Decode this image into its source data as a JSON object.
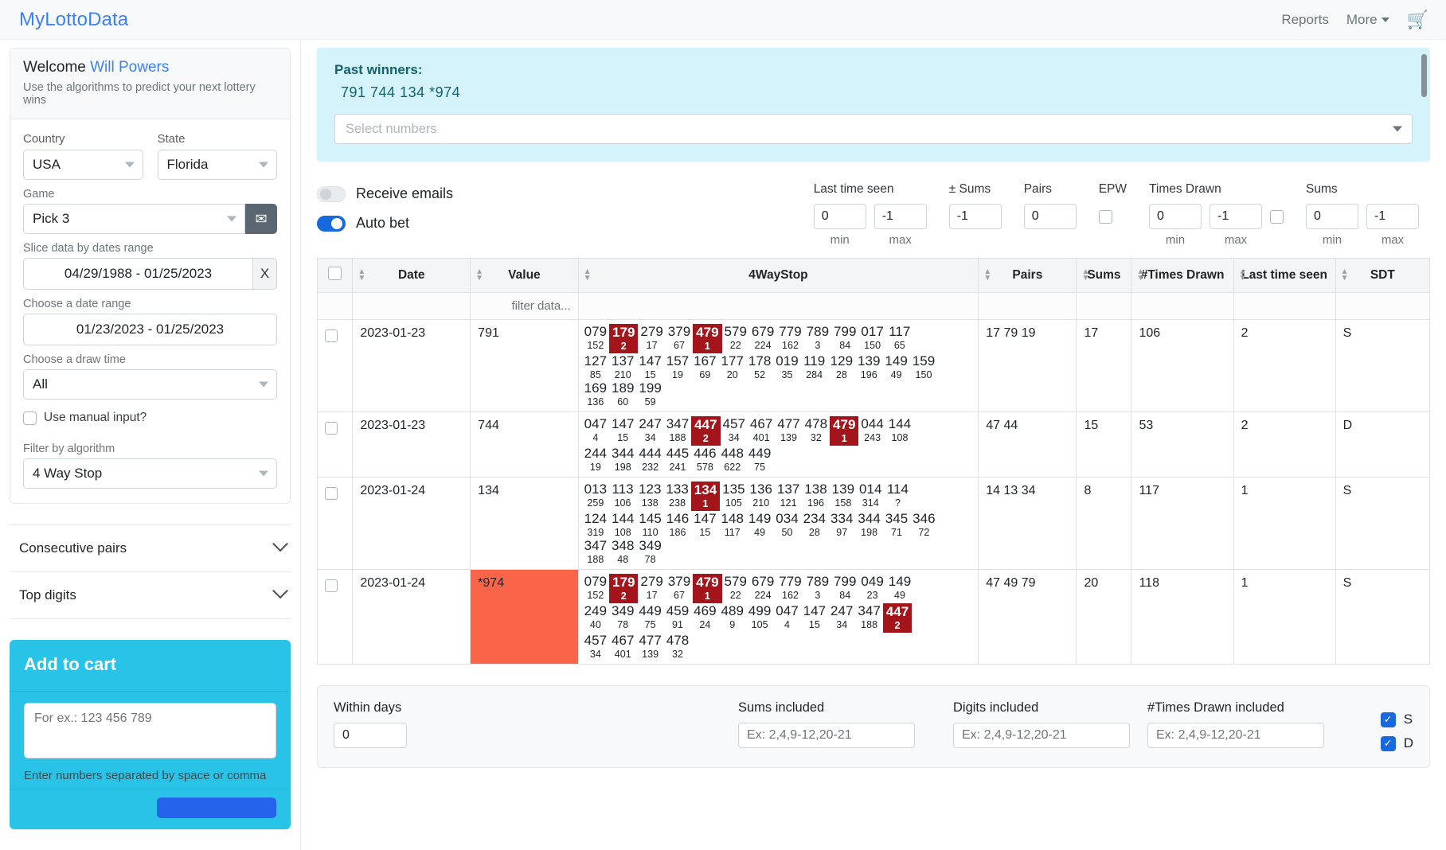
{
  "nav": {
    "brand": "MyLottoData",
    "links": [
      "Reports",
      "More"
    ],
    "cart_icon": "shopping-cart-icon"
  },
  "sidebar": {
    "welcome_prefix": "Welcome ",
    "user": "Will Powers",
    "subtitle": "Use the algorithms to predict your next lottery wins",
    "country_label": "Country",
    "country_value": "USA",
    "state_label": "State",
    "state_value": "Florida",
    "game_label": "Game",
    "game_value": "Pick 3",
    "mail_icon": "envelope-icon",
    "slice_label": "Slice data by dates range",
    "slice_value": "04/29/1988 - 01/25/2023",
    "slice_clear": "X",
    "range_label": "Choose a date range",
    "range_value": "01/23/2023 - 01/25/2023",
    "drawtime_label": "Choose a draw time",
    "drawtime_value": "All",
    "manual_label": "Use manual input?",
    "algo_label": "Filter by algorithm",
    "algo_value": "4 Way Stop",
    "accordion": [
      "Consecutive pairs",
      "Top digits"
    ],
    "cart_title": "Add to cart",
    "cart_placeholder": "For ex.: 123 456 789",
    "cart_hint": "Enter numbers separated by space or comma"
  },
  "past_winners": {
    "title": "Past winners:",
    "numbers": "791  744  134  *974",
    "select_placeholder": "Select numbers"
  },
  "controls": {
    "receive_emails_label": "Receive emails",
    "receive_emails_on": false,
    "auto_bet_label": "Auto bet",
    "auto_bet_on": true,
    "groups": [
      {
        "title": "Last time seen",
        "inputs": [
          "0",
          "-1"
        ],
        "minmax": [
          "min",
          "max"
        ],
        "checkbox": false
      },
      {
        "title": "± Sums",
        "inputs": [
          "-1"
        ],
        "minmax": [],
        "checkbox": false
      },
      {
        "title": "Pairs",
        "inputs": [
          "0"
        ],
        "minmax": [],
        "checkbox": false
      },
      {
        "title": "EPW",
        "inputs": [],
        "minmax": [],
        "checkbox": true
      },
      {
        "title": "Times Drawn",
        "inputs": [
          "0",
          "-1"
        ],
        "minmax": [
          "min",
          "max"
        ],
        "checkbox": true
      },
      {
        "title": "Sums",
        "inputs": [
          "0",
          "-1"
        ],
        "minmax": [
          "min",
          "max"
        ],
        "checkbox": false
      }
    ]
  },
  "table": {
    "columns": [
      "Date",
      "Value",
      "4WayStop",
      "Pairs",
      "Sums",
      "#Times Drawn",
      "Last time seen",
      "SDT"
    ],
    "filter_placeholder": "filter data...",
    "rows": [
      {
        "date": "2023-01-23",
        "value": "791",
        "value_highlight": false,
        "lines": [
          [
            [
              "079",
              "152",
              false
            ],
            [
              "179",
              "2",
              true
            ],
            [
              "279",
              "17",
              false
            ],
            [
              "379",
              "67",
              false
            ],
            [
              "479",
              "1",
              true
            ],
            [
              "579",
              "22",
              false
            ],
            [
              "679",
              "224",
              false
            ],
            [
              "779",
              "162",
              false
            ],
            [
              "789",
              "3",
              false
            ],
            [
              "799",
              "84",
              false
            ],
            [
              "017",
              "150",
              false
            ],
            [
              "117",
              "65",
              false
            ]
          ],
          [
            [
              "127",
              "85",
              false
            ],
            [
              "137",
              "210",
              false
            ],
            [
              "147",
              "15",
              false
            ],
            [
              "157",
              "19",
              false
            ],
            [
              "167",
              "69",
              false
            ],
            [
              "177",
              "20",
              false
            ],
            [
              "178",
              "52",
              false
            ],
            [
              "019",
              "35",
              false
            ],
            [
              "119",
              "284",
              false
            ],
            [
              "129",
              "28",
              false
            ],
            [
              "139",
              "196",
              false
            ],
            [
              "149",
              "49",
              false
            ],
            [
              "159",
              "150",
              false
            ]
          ],
          [
            [
              "169",
              "136",
              false
            ],
            [
              "189",
              "60",
              false
            ],
            [
              "199",
              "59",
              false
            ]
          ]
        ],
        "pairs": "17 79 19",
        "sums": "17",
        "times_drawn": "106",
        "last_time_seen": "2",
        "sdt": "S"
      },
      {
        "date": "2023-01-23",
        "value": "744",
        "value_highlight": false,
        "lines": [
          [
            [
              "047",
              "4",
              false
            ],
            [
              "147",
              "15",
              false
            ],
            [
              "247",
              "34",
              false
            ],
            [
              "347",
              "188",
              false
            ],
            [
              "447",
              "2",
              true
            ],
            [
              "457",
              "34",
              false
            ],
            [
              "467",
              "401",
              false
            ],
            [
              "477",
              "139",
              false
            ],
            [
              "478",
              "32",
              false
            ],
            [
              "479",
              "1",
              true
            ],
            [
              "044",
              "243",
              false
            ],
            [
              "144",
              "108",
              false
            ]
          ],
          [
            [
              "244",
              "19",
              false
            ],
            [
              "344",
              "198",
              false
            ],
            [
              "444",
              "232",
              false
            ],
            [
              "445",
              "241",
              false
            ],
            [
              "446",
              "578",
              false
            ],
            [
              "448",
              "622",
              false
            ],
            [
              "449",
              "75",
              false
            ]
          ]
        ],
        "pairs": "47 44",
        "sums": "15",
        "times_drawn": "53",
        "last_time_seen": "2",
        "sdt": "D"
      },
      {
        "date": "2023-01-24",
        "value": "134",
        "value_highlight": false,
        "lines": [
          [
            [
              "013",
              "259",
              false
            ],
            [
              "113",
              "106",
              false
            ],
            [
              "123",
              "138",
              false
            ],
            [
              "133",
              "238",
              false
            ],
            [
              "134",
              "1",
              true
            ],
            [
              "135",
              "105",
              false
            ],
            [
              "136",
              "210",
              false
            ],
            [
              "137",
              "121",
              false
            ],
            [
              "138",
              "196",
              false
            ],
            [
              "139",
              "158",
              false
            ],
            [
              "014",
              "314",
              false
            ],
            [
              "114",
              "?",
              false
            ]
          ],
          [
            [
              "124",
              "319",
              false
            ],
            [
              "144",
              "108",
              false
            ],
            [
              "145",
              "110",
              false
            ],
            [
              "146",
              "186",
              false
            ],
            [
              "147",
              "15",
              false
            ],
            [
              "148",
              "117",
              false
            ],
            [
              "149",
              "49",
              false
            ],
            [
              "034",
              "50",
              false
            ],
            [
              "234",
              "28",
              false
            ],
            [
              "334",
              "97",
              false
            ],
            [
              "344",
              "198",
              false
            ],
            [
              "345",
              "71",
              false
            ],
            [
              "346",
              "72",
              false
            ]
          ],
          [
            [
              "347",
              "188",
              false
            ],
            [
              "348",
              "48",
              false
            ],
            [
              "349",
              "78",
              false
            ]
          ]
        ],
        "pairs": "14 13 34",
        "sums": "8",
        "times_drawn": "117",
        "last_time_seen": "1",
        "sdt": "S"
      },
      {
        "date": "2023-01-24",
        "value": "*974",
        "value_highlight": true,
        "lines": [
          [
            [
              "079",
              "152",
              false
            ],
            [
              "179",
              "2",
              true
            ],
            [
              "279",
              "17",
              false
            ],
            [
              "379",
              "67",
              false
            ],
            [
              "479",
              "1",
              true
            ],
            [
              "579",
              "22",
              false
            ],
            [
              "679",
              "224",
              false
            ],
            [
              "779",
              "162",
              false
            ],
            [
              "789",
              "3",
              false
            ],
            [
              "799",
              "84",
              false
            ],
            [
              "049",
              "23",
              false
            ],
            [
              "149",
              "49",
              false
            ]
          ],
          [
            [
              "249",
              "40",
              false
            ],
            [
              "349",
              "78",
              false
            ],
            [
              "449",
              "75",
              false
            ],
            [
              "459",
              "91",
              false
            ],
            [
              "469",
              "24",
              false
            ],
            [
              "489",
              "9",
              false
            ],
            [
              "499",
              "105",
              false
            ],
            [
              "047",
              "4",
              false
            ],
            [
              "147",
              "15",
              false
            ],
            [
              "247",
              "34",
              false
            ],
            [
              "347",
              "188",
              false
            ],
            [
              "447",
              "2",
              true
            ]
          ],
          [
            [
              "457",
              "34",
              false
            ],
            [
              "467",
              "401",
              false
            ],
            [
              "477",
              "139",
              false
            ],
            [
              "478",
              "32",
              false
            ]
          ]
        ],
        "pairs": "47 49 79",
        "sums": "20",
        "times_drawn": "118",
        "last_time_seen": "1",
        "sdt": "S"
      }
    ]
  },
  "bottom": {
    "within_days_label": "Within days",
    "within_days_value": "0",
    "sums_included_label": "Sums included",
    "sums_included_placeholder": "Ex: 2,4,9-12,20-21",
    "digits_included_label": "Digits included",
    "digits_included_placeholder": "Ex: 2,4,9-12,20-21",
    "times_drawn_included_label": "#Times Drawn included",
    "times_drawn_included_placeholder": "Ex: 2,4,9-12,20-21",
    "sd_checks": [
      {
        "label": "S",
        "checked": true
      },
      {
        "label": "D",
        "checked": true
      }
    ]
  },
  "colors": {
    "brand": "#3b82f6",
    "accent_cyan": "#29c3e8",
    "hot_red": "#a4151b",
    "value_orange": "#fa6449",
    "pastwinners_bg": "#d4f3fb"
  }
}
